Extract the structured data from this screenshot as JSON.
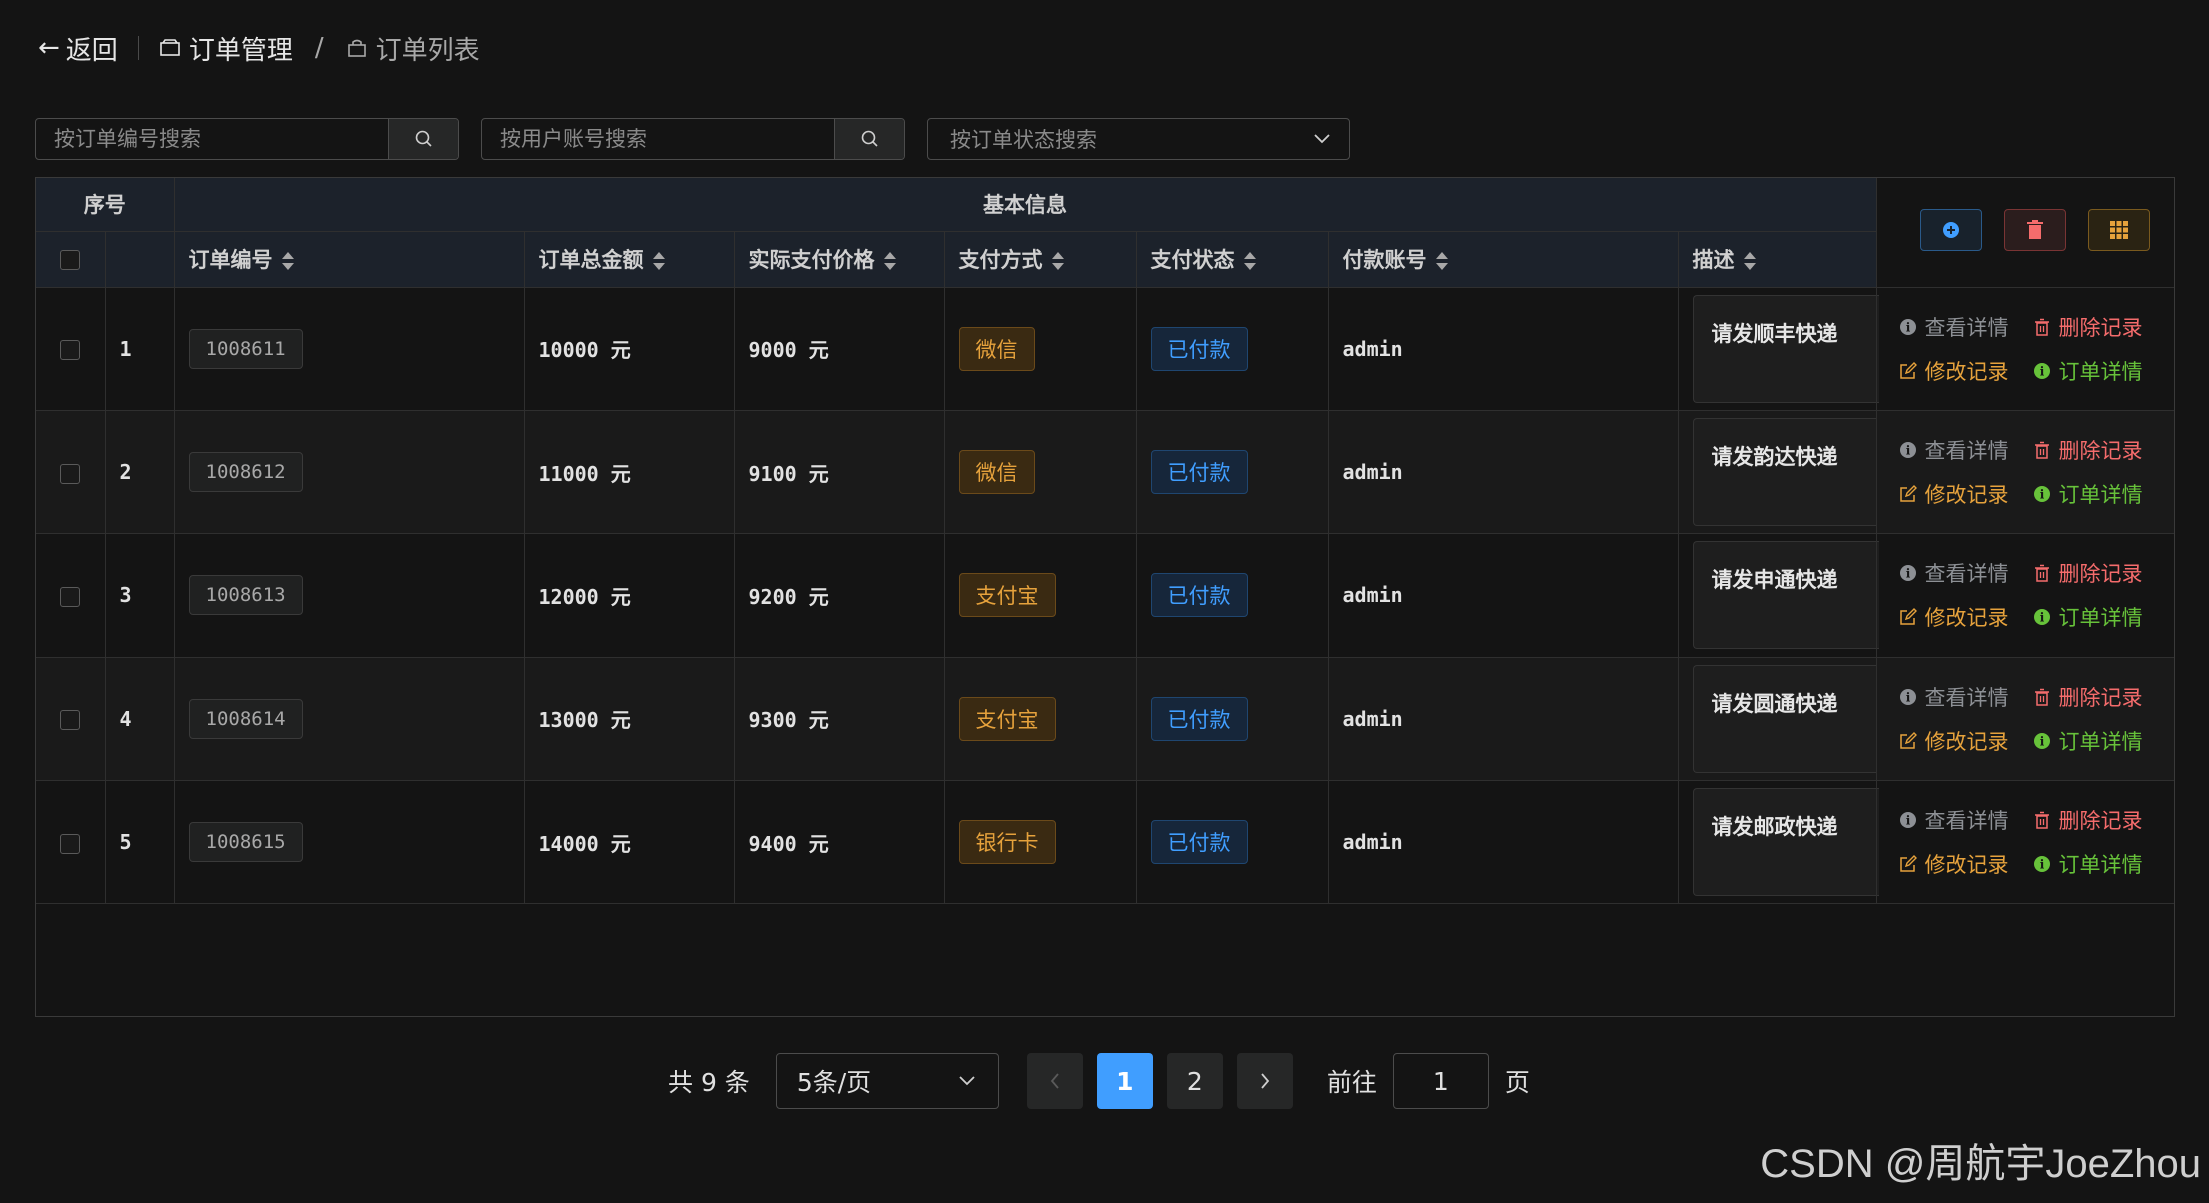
{
  "header": {
    "back_label": "返回",
    "crumb1": "订单管理",
    "separator": "/",
    "crumb2": "订单列表"
  },
  "search": {
    "order_no_placeholder": "按订单编号搜索",
    "account_placeholder": "按用户账号搜索",
    "status_placeholder": "按订单状态搜索"
  },
  "table": {
    "group_headers": {
      "seq": "序号",
      "basic": "基本信息"
    },
    "columns": [
      "订单编号",
      "订单总金额",
      "实际支付价格",
      "支付方式",
      "支付状态",
      "付款账号",
      "描述"
    ],
    "rows": [
      {
        "idx": "1",
        "order_no": "1008611",
        "total": "10000 元",
        "paid": "9000 元",
        "method": "微信",
        "status": "已付款",
        "account": "admin",
        "desc": "请发顺丰快递"
      },
      {
        "idx": "2",
        "order_no": "1008612",
        "total": "11000 元",
        "paid": "9100 元",
        "method": "微信",
        "status": "已付款",
        "account": "admin",
        "desc": "请发韵达快递"
      },
      {
        "idx": "3",
        "order_no": "1008613",
        "total": "12000 元",
        "paid": "9200 元",
        "method": "支付宝",
        "status": "已付款",
        "account": "admin",
        "desc": "请发申通快递"
      },
      {
        "idx": "4",
        "order_no": "1008614",
        "total": "13000 元",
        "paid": "9300 元",
        "method": "支付宝",
        "status": "已付款",
        "account": "admin",
        "desc": "请发圆通快递"
      },
      {
        "idx": "5",
        "order_no": "1008615",
        "total": "14000 元",
        "paid": "9400 元",
        "method": "银行卡",
        "status": "已付款",
        "account": "admin",
        "desc": "请发邮政快递"
      }
    ],
    "ops": {
      "view": "查看详情",
      "delete": "删除记录",
      "edit": "修改记录",
      "detail": "订单详情"
    }
  },
  "pagination": {
    "total_text": "共 9 条",
    "page_size": "5条/页",
    "pages": [
      "1",
      "2"
    ],
    "current_page": "1",
    "goto_label": "前往",
    "goto_value": "1",
    "goto_suffix": "页"
  },
  "watermark": "CSDN @周航宇JoeZhou",
  "colors": {
    "primary": "#409eff",
    "warning": "#e6a23c",
    "danger": "#f56c6c",
    "success": "#67c23a",
    "info": "#8d9095"
  }
}
